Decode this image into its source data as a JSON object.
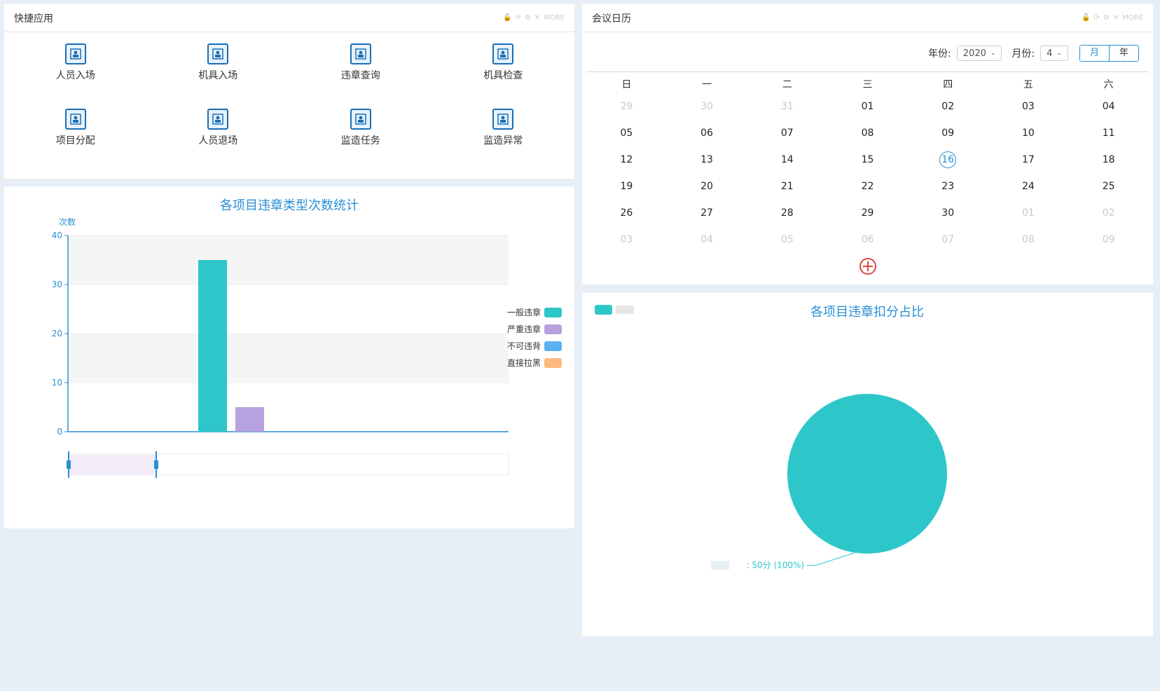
{
  "quick": {
    "title": "快捷应用",
    "more_label": "MORE",
    "items": [
      {
        "label": "人员入场",
        "icon": "person-enter-icon"
      },
      {
        "label": "机具入场",
        "icon": "machine-enter-icon"
      },
      {
        "label": "违章查询",
        "icon": "violation-query-icon"
      },
      {
        "label": "机具检查",
        "icon": "machine-check-icon"
      },
      {
        "label": "项目分配",
        "icon": "project-assign-icon"
      },
      {
        "label": "人员退场",
        "icon": "person-exit-icon"
      },
      {
        "label": "监造任务",
        "icon": "supervision-task-icon"
      },
      {
        "label": "监造异常",
        "icon": "supervision-anomaly-icon"
      }
    ]
  },
  "calendar": {
    "title": "会议日历",
    "more_label": "MORE",
    "year_label": "年份:",
    "year_value": "2020",
    "month_label": "月份:",
    "month_value": "4",
    "view_month": "月",
    "view_year": "年",
    "weekdays": [
      "日",
      "一",
      "二",
      "三",
      "四",
      "五",
      "六"
    ],
    "days": [
      {
        "d": "29",
        "other": true
      },
      {
        "d": "30",
        "other": true
      },
      {
        "d": "31",
        "other": true
      },
      {
        "d": "01"
      },
      {
        "d": "02"
      },
      {
        "d": "03"
      },
      {
        "d": "04"
      },
      {
        "d": "05"
      },
      {
        "d": "06"
      },
      {
        "d": "07"
      },
      {
        "d": "08"
      },
      {
        "d": "09"
      },
      {
        "d": "10"
      },
      {
        "d": "11"
      },
      {
        "d": "12"
      },
      {
        "d": "13"
      },
      {
        "d": "14"
      },
      {
        "d": "15"
      },
      {
        "d": "16",
        "today": true
      },
      {
        "d": "17"
      },
      {
        "d": "18"
      },
      {
        "d": "19"
      },
      {
        "d": "20"
      },
      {
        "d": "21"
      },
      {
        "d": "22"
      },
      {
        "d": "23"
      },
      {
        "d": "24"
      },
      {
        "d": "25"
      },
      {
        "d": "26"
      },
      {
        "d": "27"
      },
      {
        "d": "28"
      },
      {
        "d": "29"
      },
      {
        "d": "30"
      },
      {
        "d": "01",
        "other": true
      },
      {
        "d": "02",
        "other": true
      },
      {
        "d": "03",
        "other": true
      },
      {
        "d": "04",
        "other": true
      },
      {
        "d": "05",
        "other": true
      },
      {
        "d": "06",
        "other": true
      },
      {
        "d": "07",
        "other": true
      },
      {
        "d": "08",
        "other": true
      },
      {
        "d": "09",
        "other": true
      }
    ]
  },
  "chart_data": [
    {
      "type": "bar",
      "title": "各项目违章类型次数统计",
      "ylabel": "次数",
      "ylim": [
        0,
        40
      ],
      "yticks": [
        0,
        10,
        20,
        30,
        40
      ],
      "categories": [
        ""
      ],
      "series": [
        {
          "name": "一般违章",
          "color": "#2ec7c9",
          "values": [
            35
          ]
        },
        {
          "name": "严重违章",
          "color": "#b6a2de",
          "values": [
            5
          ]
        },
        {
          "name": "不可违背",
          "color": "#5ab1ef",
          "values": [
            0
          ]
        },
        {
          "name": "直接拉黑",
          "color": "#ffb980",
          "values": [
            0
          ]
        }
      ],
      "legend": "right",
      "grid": true
    },
    {
      "type": "pie",
      "title": "各项目违章扣分占比",
      "slices": [
        {
          "name": "",
          "value": 50,
          "color": "#2ec7c9",
          "label": ": 50分 (100%)"
        }
      ],
      "legend": "top-left"
    }
  ]
}
